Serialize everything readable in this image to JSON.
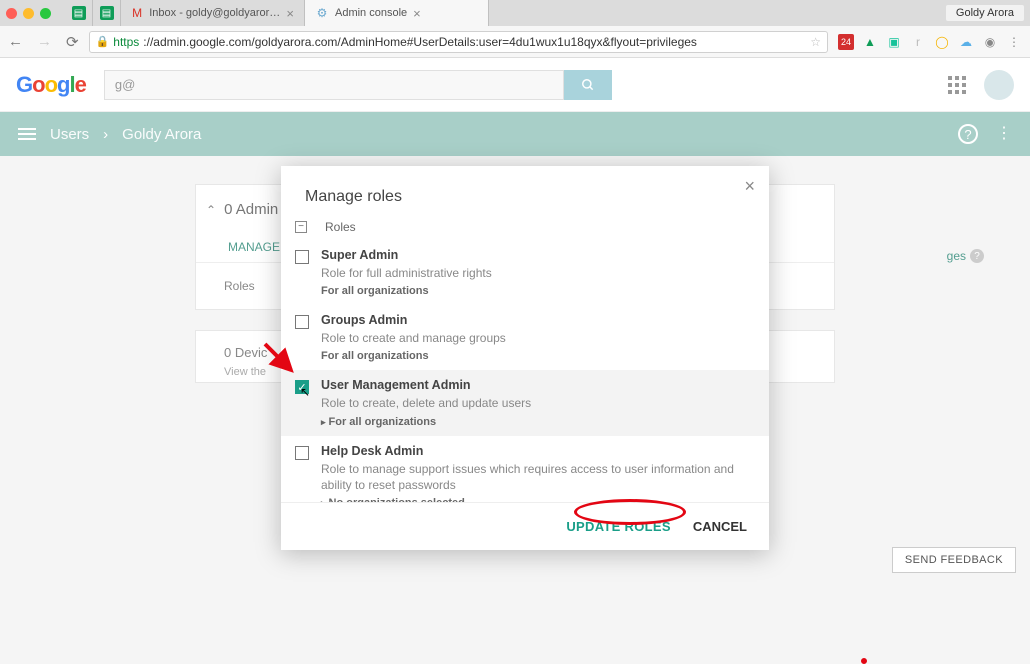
{
  "browser": {
    "profile": "Goldy Arora",
    "tabs": [
      {
        "label": ""
      },
      {
        "label": "Inbox - goldy@goldyarora.com"
      },
      {
        "label": "Admin console"
      }
    ],
    "url_secure_prefix": "https",
    "url_rest": "://admin.google.com/goldyarora.com/AdminHome#UserDetails:user=4du1wux1u18qyx&flyout=privileges"
  },
  "appHeader": {
    "searchValue": "g@"
  },
  "subheader": {
    "crumb1": "Users",
    "crumb2": "Goldy Arora"
  },
  "panel": {
    "sectionTitle": "0 Admin",
    "tabVisible": "MANAGE",
    "leftLabel": "Roles",
    "privilegesLabel": "ges"
  },
  "devices": {
    "title": "0 Devic",
    "sub": "View the"
  },
  "feedback": "SEND FEEDBACK",
  "modal": {
    "title": "Manage roles",
    "rolesHeader": "Roles",
    "roles": [
      {
        "title": "Super Admin",
        "desc": "Role for full administrative rights",
        "org": "For all organizations",
        "expander": false,
        "checked": false
      },
      {
        "title": "Groups Admin",
        "desc": "Role to create and manage groups",
        "org": "For all organizations",
        "expander": false,
        "checked": false
      },
      {
        "title": "User Management Admin",
        "desc": "Role to create, delete and update users",
        "org": "For all organizations",
        "expander": true,
        "checked": true
      },
      {
        "title": "Help Desk Admin",
        "desc": "Role to manage support issues which requires access to user information and ability to reset passwords",
        "org": "No organizations selected",
        "expander": true,
        "checked": false
      }
    ],
    "updateLabel": "UPDATE ROLES",
    "cancelLabel": "CANCEL"
  }
}
